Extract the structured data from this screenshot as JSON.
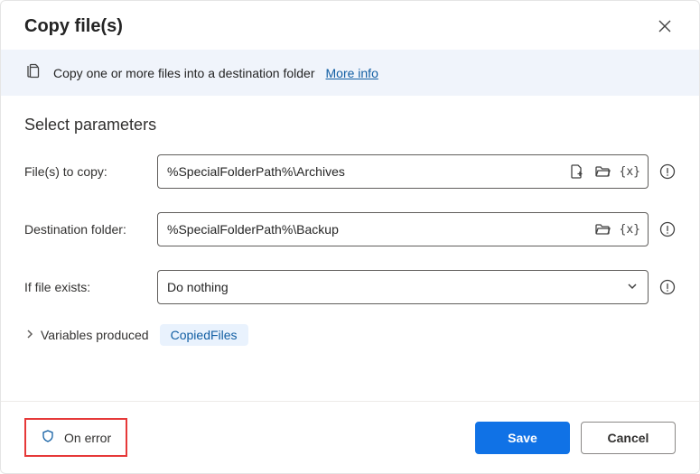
{
  "dialog": {
    "title": "Copy file(s)"
  },
  "info": {
    "text": "Copy one or more files into a destination folder",
    "more_info": "More info"
  },
  "section": {
    "title": "Select parameters"
  },
  "fields": {
    "files_to_copy": {
      "label": "File(s) to copy:",
      "value": "%SpecialFolderPath%\\Archives"
    },
    "destination_folder": {
      "label": "Destination folder:",
      "value": "%SpecialFolderPath%\\Backup"
    },
    "if_exists": {
      "label": "If file exists:",
      "value": "Do nothing"
    }
  },
  "variables": {
    "label": "Variables produced",
    "chip": "CopiedFiles"
  },
  "footer": {
    "on_error": "On error",
    "save": "Save",
    "cancel": "Cancel"
  },
  "icons": {
    "variable": "{x}"
  }
}
